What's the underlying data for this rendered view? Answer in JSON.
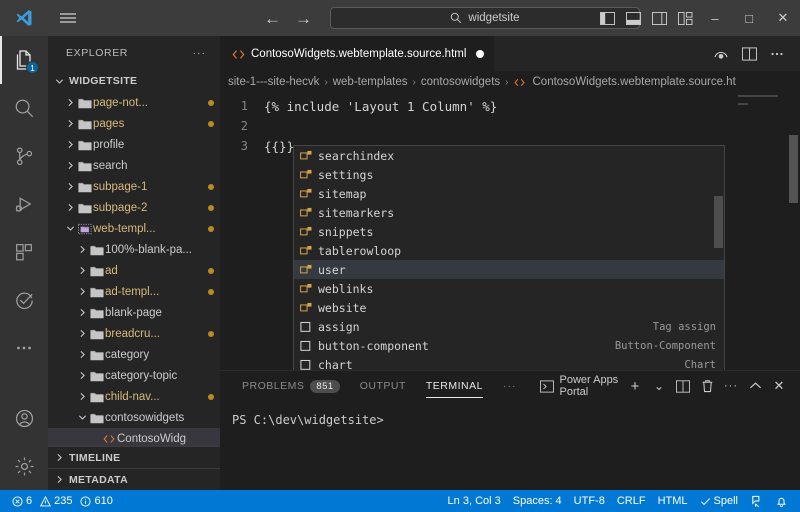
{
  "titlebar": {
    "search_value": "widgetsite",
    "back_label": "←",
    "forward_label": "→",
    "minimize_label": "–",
    "maximize_label": "□",
    "close_label": "✕"
  },
  "activitybar": {
    "explorer_badge": "1",
    "items": [
      {
        "name": "explorer",
        "icon": "files-icon"
      },
      {
        "name": "search",
        "icon": "search-icon"
      },
      {
        "name": "source-control",
        "icon": "source-control-icon"
      },
      {
        "name": "run-and-debug",
        "icon": "run-debug-icon"
      },
      {
        "name": "extensions",
        "icon": "extensions-icon"
      },
      {
        "name": "testing",
        "icon": "check-circle-icon"
      },
      {
        "name": "more",
        "icon": "ellipsis-icon"
      }
    ],
    "accounts_label": "Accounts",
    "settings_label": "Manage"
  },
  "sidebar": {
    "header": "EXPLORER",
    "more_label": "···",
    "root": "WIDGETSITE",
    "tree": [
      {
        "label": "page-not...",
        "indent": 1,
        "arrow": "collapsed",
        "modified": true,
        "dot": true,
        "type": "folder"
      },
      {
        "label": "pages",
        "indent": 1,
        "arrow": "collapsed",
        "modified": true,
        "dot": true,
        "type": "folder"
      },
      {
        "label": "profile",
        "indent": 1,
        "arrow": "collapsed",
        "modified": false,
        "dot": false,
        "type": "folder"
      },
      {
        "label": "search",
        "indent": 1,
        "arrow": "collapsed",
        "modified": false,
        "dot": false,
        "type": "folder"
      },
      {
        "label": "subpage-1",
        "indent": 1,
        "arrow": "collapsed",
        "modified": true,
        "dot": true,
        "type": "folder"
      },
      {
        "label": "subpage-2",
        "indent": 1,
        "arrow": "collapsed",
        "modified": true,
        "dot": true,
        "type": "folder"
      },
      {
        "label": "web-templ...",
        "indent": 1,
        "arrow": "expanded",
        "modified": true,
        "dot": true,
        "type": "folder-open"
      },
      {
        "label": "100%-blank-pa...",
        "indent": 2,
        "arrow": "collapsed",
        "modified": false,
        "dot": false,
        "type": "folder"
      },
      {
        "label": "ad",
        "indent": 2,
        "arrow": "collapsed",
        "modified": true,
        "dot": true,
        "type": "folder"
      },
      {
        "label": "ad-templ...",
        "indent": 2,
        "arrow": "collapsed",
        "modified": true,
        "dot": true,
        "type": "folder"
      },
      {
        "label": "blank-page",
        "indent": 2,
        "arrow": "collapsed",
        "modified": false,
        "dot": false,
        "type": "folder"
      },
      {
        "label": "breadcru...",
        "indent": 2,
        "arrow": "collapsed",
        "modified": true,
        "dot": true,
        "type": "folder"
      },
      {
        "label": "category",
        "indent": 2,
        "arrow": "collapsed",
        "modified": false,
        "dot": false,
        "type": "folder"
      },
      {
        "label": "category-topic",
        "indent": 2,
        "arrow": "collapsed",
        "modified": false,
        "dot": false,
        "type": "folder"
      },
      {
        "label": "child-nav...",
        "indent": 2,
        "arrow": "collapsed",
        "modified": true,
        "dot": true,
        "type": "folder"
      },
      {
        "label": "contosowidgets",
        "indent": 2,
        "arrow": "expanded",
        "modified": false,
        "dot": false,
        "type": "folder"
      },
      {
        "label": "ContosoWidg",
        "indent": 3,
        "arrow": "none",
        "modified": false,
        "dot": false,
        "type": "html-file",
        "selected": true
      }
    ],
    "timeline": "TIMELINE",
    "metadata": "METADATA"
  },
  "editor": {
    "tab_label": "ContosoWidgets.webtemplate.source.html",
    "tab_dirty": true,
    "actions": [
      {
        "name": "preview-icon"
      },
      {
        "name": "split-editor-icon"
      },
      {
        "name": "more-actions-icon"
      }
    ],
    "breadcrumb": [
      "site-1---site-hecvk",
      "web-templates",
      "contosowidgets",
      "ContosoWidgets.webtemplate.source.ht"
    ],
    "breadcrumb_separator": "›",
    "lines": [
      {
        "num": "1",
        "text": "{% include 'Layout 1 Column' %}"
      },
      {
        "num": "2",
        "text": ""
      },
      {
        "num": "3",
        "text": "{{}}"
      }
    ]
  },
  "suggest": {
    "items": [
      {
        "label": "searchindex",
        "detail": "",
        "kind": "object",
        "selected": false
      },
      {
        "label": "settings",
        "detail": "",
        "kind": "object",
        "selected": false
      },
      {
        "label": "sitemap",
        "detail": "",
        "kind": "object",
        "selected": false
      },
      {
        "label": "sitemarkers",
        "detail": "",
        "kind": "object",
        "selected": false
      },
      {
        "label": "snippets",
        "detail": "",
        "kind": "object",
        "selected": false
      },
      {
        "label": "tablerowloop",
        "detail": "",
        "kind": "object",
        "selected": false
      },
      {
        "label": "user",
        "detail": "",
        "kind": "object",
        "selected": true
      },
      {
        "label": "weblinks",
        "detail": "",
        "kind": "object",
        "selected": false
      },
      {
        "label": "website",
        "detail": "",
        "kind": "object",
        "selected": false
      },
      {
        "label": "assign",
        "detail": "Tag assign",
        "kind": "keyword",
        "selected": false
      },
      {
        "label": "button-component",
        "detail": "Button-Component",
        "kind": "keyword",
        "selected": false
      },
      {
        "label": "chart",
        "detail": "Chart",
        "kind": "keyword",
        "selected": false
      }
    ]
  },
  "panel": {
    "tabs": [
      {
        "label": "PROBLEMS",
        "badge": "851",
        "active": false
      },
      {
        "label": "OUTPUT",
        "badge": "",
        "active": false
      },
      {
        "label": "TERMINAL",
        "badge": "",
        "active": true
      }
    ],
    "more_label": "···",
    "terminal_name": "Power Apps Portal",
    "actions": [
      {
        "name": "new-terminal-icon",
        "glyph": "+"
      },
      {
        "name": "terminal-dropdown-icon",
        "glyph": "⌄"
      },
      {
        "name": "split-terminal-icon",
        "glyph": ""
      },
      {
        "name": "kill-terminal-icon",
        "glyph": ""
      },
      {
        "name": "panel-more-icon",
        "glyph": "···"
      },
      {
        "name": "maximize-panel-icon",
        "glyph": "⌃"
      },
      {
        "name": "close-panel-icon",
        "glyph": "✕"
      }
    ],
    "prompt": "PS C:\\dev\\widgetsite>"
  },
  "statusbar": {
    "errors": "6",
    "warnings": "235",
    "infos": "610",
    "cursor": "Ln 3, Col 3",
    "spaces": "Spaces: 4",
    "encoding": "UTF-8",
    "eol": "CRLF",
    "language": "HTML",
    "spell": "Spell",
    "accent": "#0078d4"
  }
}
